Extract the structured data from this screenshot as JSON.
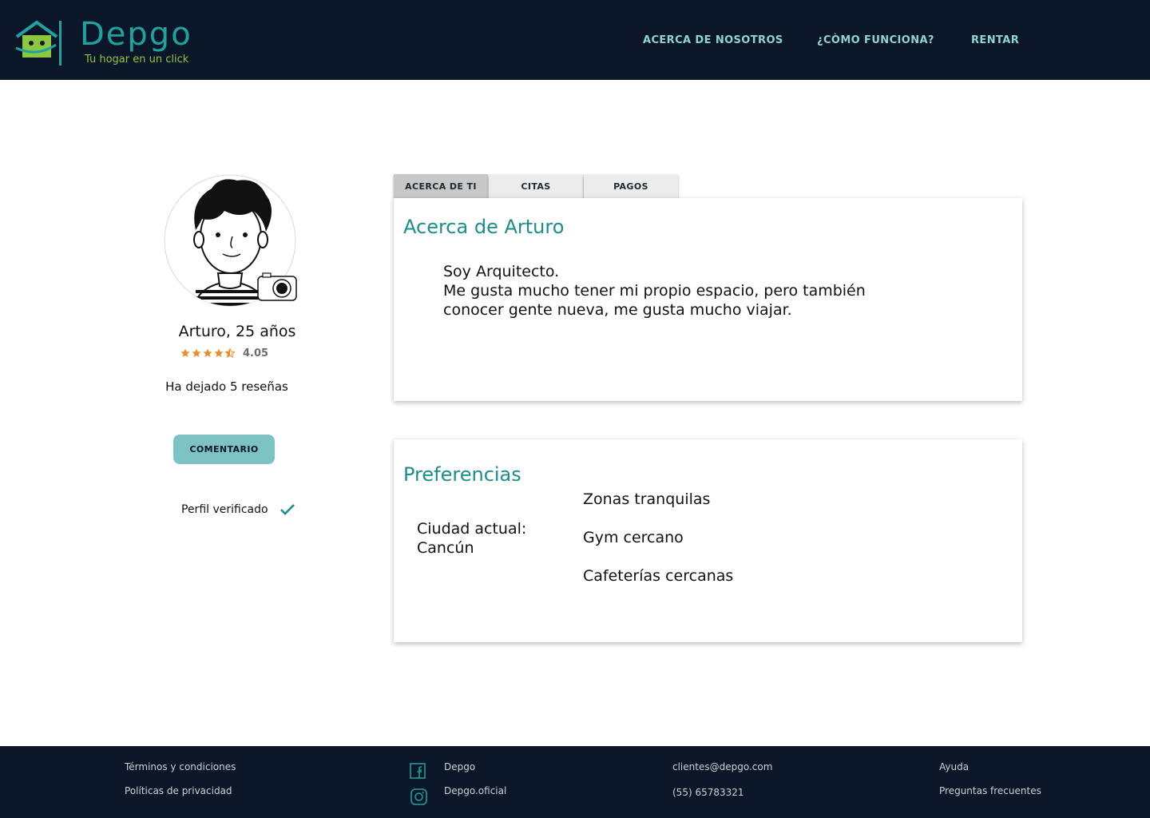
{
  "header": {
    "brand_name": "Depgo",
    "brand_tagline": "Tu hogar en un click",
    "nav": [
      "ACERCA DE NOSOTROS",
      "¿CÒMO FUNCIONA?",
      "RENTAR"
    ]
  },
  "profile": {
    "name": "Arturo, 25 años",
    "rating": 4.05,
    "rating_display": "4.05",
    "stars": 4.5,
    "reviews": "Ha dejado 5 reseñas",
    "comment_button": "COMENTARIO",
    "verified_label": "Perfil verificado"
  },
  "tabs": [
    "ACERCA DE TI",
    "CITAS",
    "PAGOS"
  ],
  "active_tab": "ACERCA DE TI",
  "about": {
    "title": "Acerca de Arturo",
    "lines": [
      "Soy Arquitecto.",
      "Me gusta mucho tener mi propio espacio, pero también",
      "conocer gente nueva, me gusta mucho viajar."
    ]
  },
  "preferences": {
    "title": "Preferencias",
    "city_label": "Ciudad actual:",
    "city": "Cancún",
    "items": [
      "Zonas tranquilas",
      "Gym cercano",
      "Cafeterías cercanas"
    ]
  },
  "footer": {
    "terms": "Términos y condiciones",
    "privacy": "Políticas  de privacidad",
    "facebook": "Depgo",
    "instagram": "Depgo.oficial",
    "email": "clientes@depgo.com",
    "phone": "(55) 65783321",
    "help": "Ayuda",
    "faq": "Preguntas frecuentes"
  },
  "colors": {
    "header_bg": "#0b1629",
    "accent": "#1fa3a0",
    "nav_text": "#8fd3d5",
    "tagline": "#8dc63f",
    "button_bg": "#7ec3c4",
    "star": "#f08a24",
    "title": "#1a8e8c"
  },
  "icons": [
    "house-logo-icon",
    "camera-icon",
    "star-icon",
    "checkmark-icon",
    "facebook-icon",
    "instagram-icon"
  ]
}
